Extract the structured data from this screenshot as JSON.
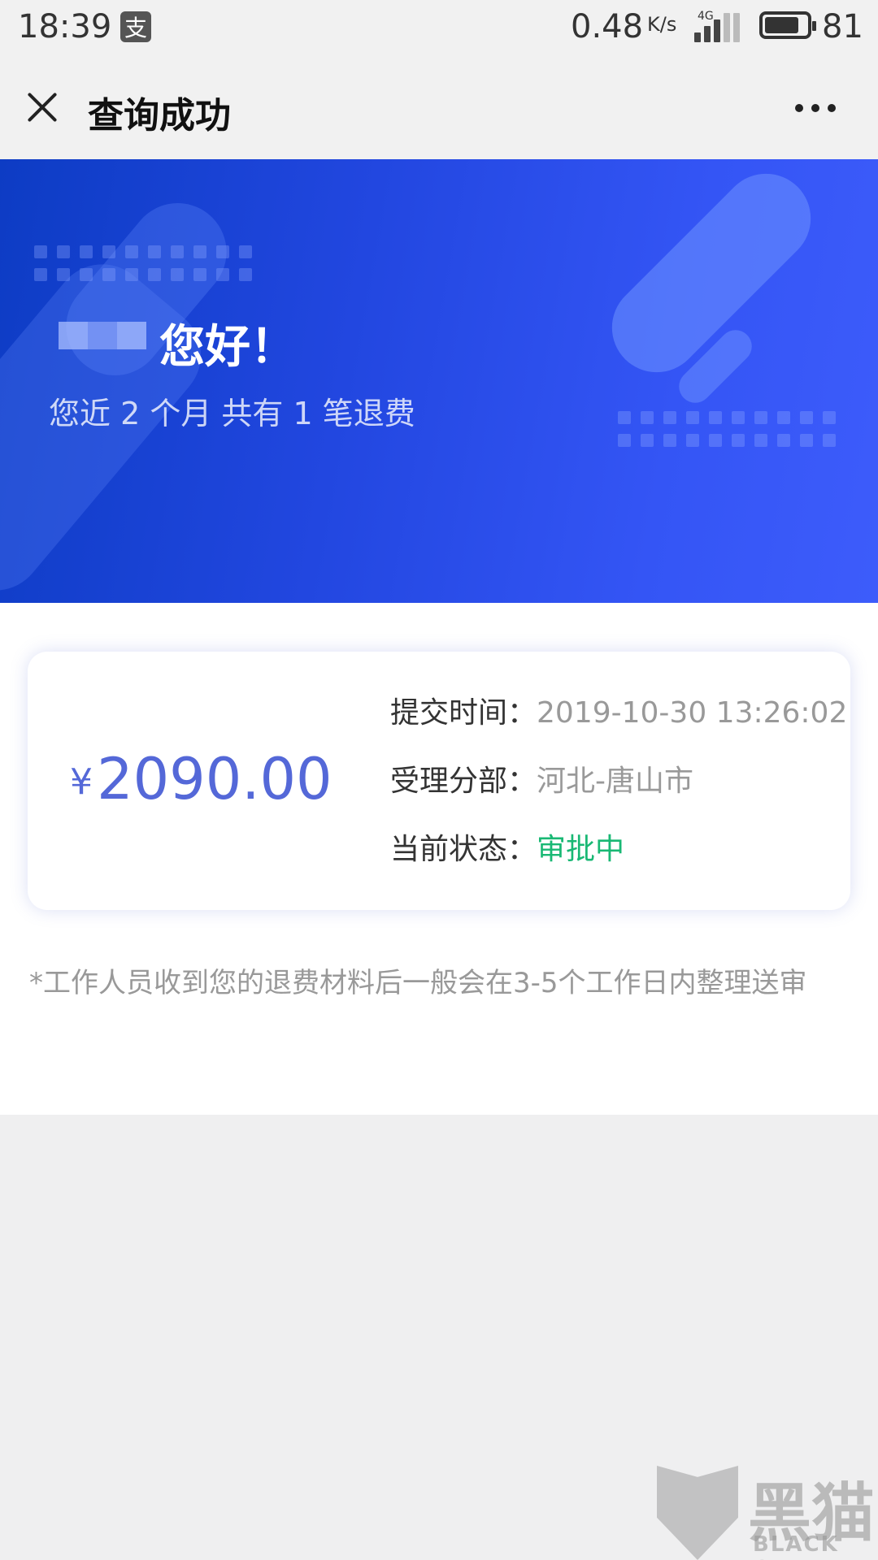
{
  "status_bar": {
    "time": "18:39",
    "app_icon_glyph": "支",
    "net_speed": "0.48",
    "net_speed_unit": "K/s",
    "network_type": "4G",
    "battery": "81",
    "battery_level": 0.81
  },
  "header": {
    "title": "查询成功",
    "close_icon": "close-icon",
    "more_icon": "more-icon"
  },
  "banner": {
    "greeting": "您好！",
    "summary": "您近 2 个月 共有 1 笔退费"
  },
  "refund": {
    "currency_symbol": "¥",
    "amount": "2090.00",
    "rows": [
      {
        "label": "提交时间：",
        "value": "2019-10-30 13:26:02"
      },
      {
        "label": "受理分部：",
        "value": "河北-唐山市"
      },
      {
        "label": "当前状态：",
        "value": "审批中"
      }
    ]
  },
  "note": "*工作人员收到您的退费材料后一般会在3-5个工作日内整理送审",
  "watermark": {
    "cn": "黑猫",
    "en": "BLACK CAT"
  },
  "colors": {
    "banner_start": "#0d3cc4",
    "banner_end": "#3d5cfb",
    "amount": "#5468d8",
    "status_pending": "#19b874"
  }
}
